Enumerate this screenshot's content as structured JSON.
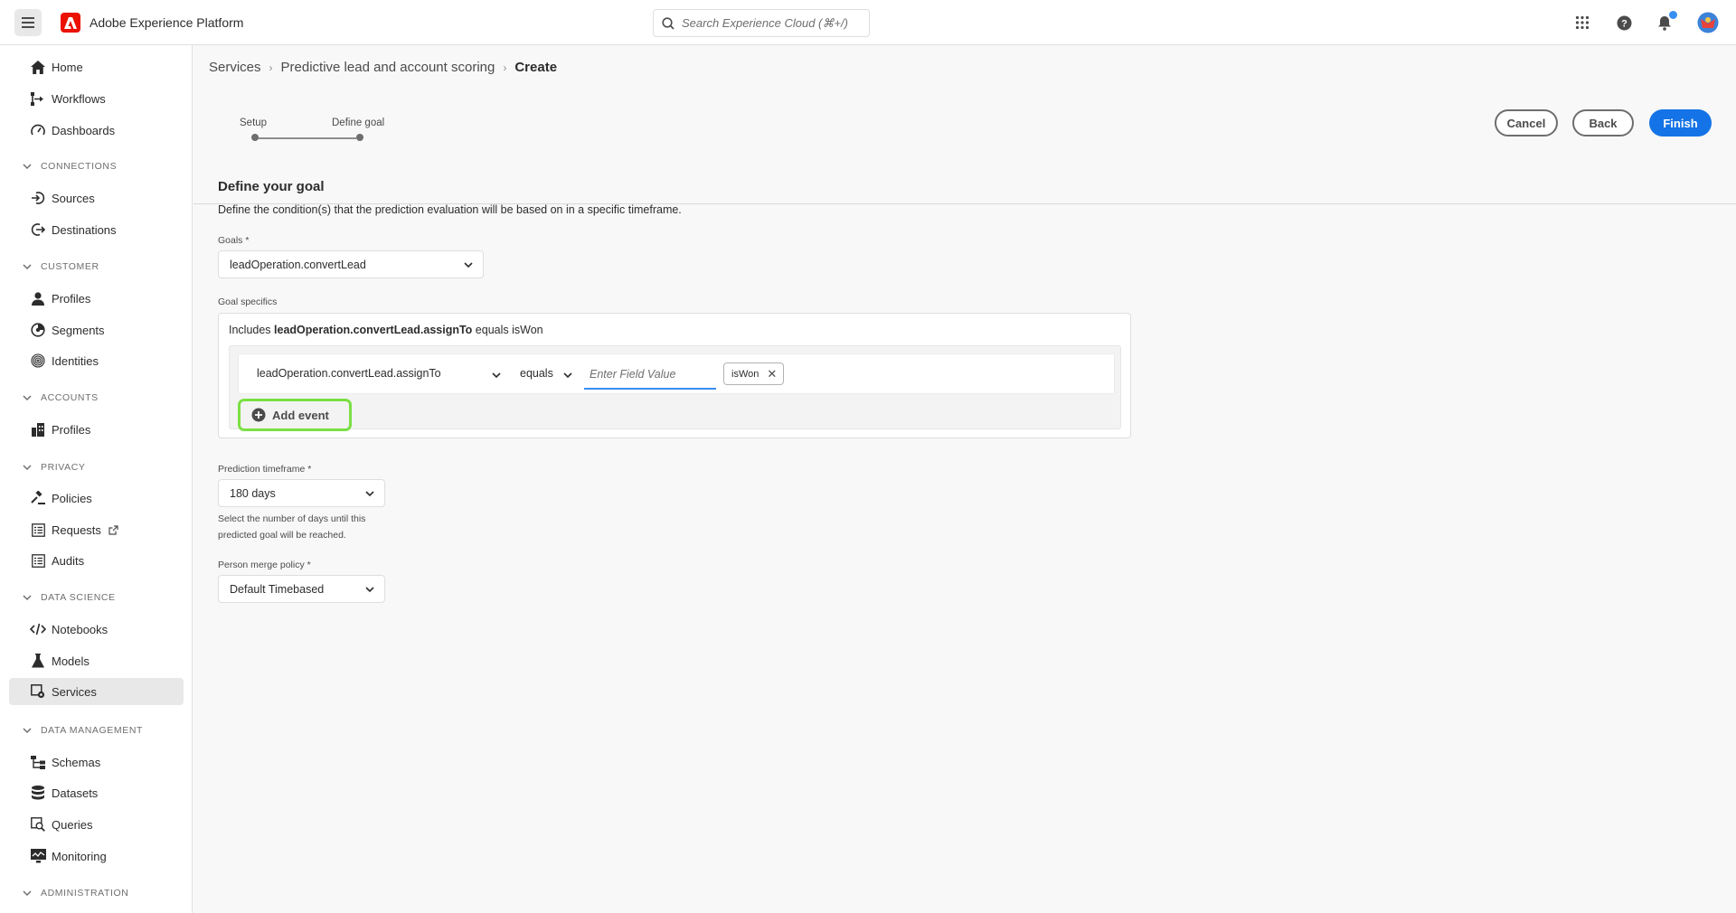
{
  "app": {
    "title": "Adobe Experience Platform",
    "search_placeholder": "Search Experience Cloud (⌘+/)"
  },
  "sidebar": {
    "items": {
      "home": "Home",
      "workflows": "Workflows",
      "dashboards": "Dashboards",
      "sources": "Sources",
      "destinations": "Destinations",
      "profiles": "Profiles",
      "segments": "Segments",
      "identities": "Identities",
      "account_profiles": "Profiles",
      "policies": "Policies",
      "requests": "Requests",
      "audits": "Audits",
      "notebooks": "Notebooks",
      "models": "Models",
      "services": "Services",
      "schemas": "Schemas",
      "datasets": "Datasets",
      "queries": "Queries",
      "monitoring": "Monitoring"
    },
    "sections": {
      "connections": "CONNECTIONS",
      "customer": "CUSTOMER",
      "accounts": "ACCOUNTS",
      "privacy": "PRIVACY",
      "data_science": "DATA SCIENCE",
      "data_management": "DATA MANAGEMENT",
      "administration": "ADMINISTRATION"
    },
    "active_item": "Services"
  },
  "breadcrumb": {
    "items": [
      "Services",
      "Predictive lead and account scoring"
    ],
    "current": "Create"
  },
  "steps": {
    "setup": "Setup",
    "define_goal": "Define goal"
  },
  "actions": {
    "cancel": "Cancel",
    "back": "Back",
    "finish": "Finish"
  },
  "form": {
    "heading": "Define your goal",
    "description": "Define the condition(s) that the prediction evaluation will be based on in a specific timeframe.",
    "goals_label": "Goals *",
    "goals_value": "leadOperation.convertLead",
    "goal_specifics_label": "Goal specifics",
    "specifics_summary": {
      "prefix": "Includes",
      "field": "leadOperation.convertLead.assignTo",
      "suffix": "equals isWon"
    },
    "condition": {
      "field": "leadOperation.convertLead.assignTo",
      "operator": "equals",
      "value_placeholder": "Enter Field Value",
      "tag": "isWon"
    },
    "add_event_label": "Add event",
    "timeframe_label": "Prediction timeframe *",
    "timeframe_value": "180 days",
    "timeframe_help": [
      "Select the number of days until this",
      "predicted goal will be reached."
    ],
    "merge_policy_label": "Person merge policy *",
    "merge_policy_value": "Default Timebased"
  },
  "colors": {
    "accent": "#1473e6",
    "highlight": "#7ae043",
    "brand": "#eb1000",
    "notification": "#378ef0"
  }
}
